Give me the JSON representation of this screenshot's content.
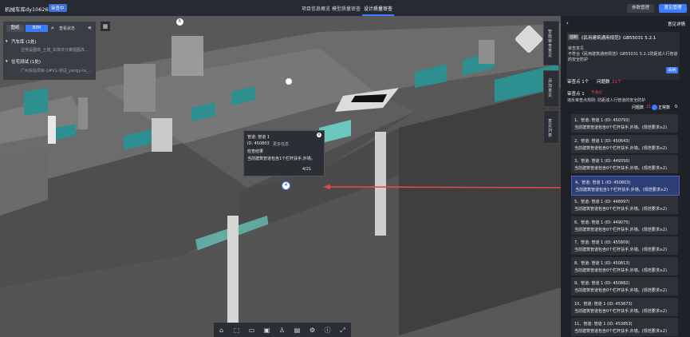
{
  "header": {
    "project": "机械车库dy10626-建筑",
    "badge": "审查中",
    "tabs": [
      "项目信息概览",
      "模型质量审查",
      "设计质量审查"
    ],
    "active_tab": "设计质量审查",
    "btn_params": "参数管理",
    "btn_manage": "意见管理"
  },
  "left_panel": {
    "seg_drawing": "图纸",
    "seg_bim": "BIM",
    "status_label": "查看状态",
    "groups": [
      {
        "label": "汽车库 (1处)",
        "sub": "住宅设图库_土建_车库日分离视图改..."
      },
      {
        "label": "住宅测试 (1处)",
        "sub": "广州东站项目-1#V1-测试_yangy-ta_..."
      }
    ]
  },
  "popup": {
    "line1": "管道: 管道 1",
    "line2": "ID: 450803",
    "more": "更多信息",
    "line3": "检查结果",
    "line4": "当前建筑管道包含1个栏杆扶手,外墙。",
    "pager": "4/21"
  },
  "right_panel": {
    "title": "意见详情",
    "tag": "强制",
    "clause": "《民用建筑通用规范》GB55031 5.2.1",
    "review_label": "审查意见",
    "review_text": "不符合《民用建筑通用规范》GB55031 5.2.1防距成人行管道的安全防护",
    "adopt_btn": "采纳",
    "stats_label": "审查点 1个",
    "issues_label": "问题数",
    "issues_count": "21个",
    "point_label": "审查点 1",
    "point_tag": "不通过",
    "point_desc": "违反审查点规则: 防距成人行管道的安全防护",
    "filter_issue": "问题数",
    "filter_count": "21",
    "filter_correct": "正常数",
    "filter_correct_count": "0",
    "items": [
      {
        "title": "1、管道: 管道 1 (ID: 450793)",
        "desc": "当前建筑管道包含0个栏杆扶手,外墙。(规范要求≥2)",
        "selected": false
      },
      {
        "title": "2、管道: 管道 1 (ID: 450643)",
        "desc": "当前建筑管道包含0个栏杆扶手,外墙。(规范要求≥2)",
        "selected": false
      },
      {
        "title": "3、管道: 管道 1 (ID: 449350)",
        "desc": "当前建筑管道包含0个栏杆扶手,外墙。(规范要求≥2)",
        "selected": false
      },
      {
        "title": "4、管道: 管道 1 (ID: 450803)",
        "desc": "当前建筑管道包含1个栏杆扶手,外墙。(规范要求≥2)",
        "selected": true
      },
      {
        "title": "5、管道: 管道 1 (ID: 448997)",
        "desc": "当前建筑管道包含0个栏杆扶手,外墙。(规范要求≥2)",
        "selected": false
      },
      {
        "title": "6、管道: 管道 1 (ID: 449075)",
        "desc": "当前建筑管道包含0个栏杆扶手,外墙。(规范要求≥2)",
        "selected": false
      },
      {
        "title": "7、管道: 管道 1 (ID: 455809)",
        "desc": "当前建筑管道包含0个栏杆扶手,外墙。(规范要求≥2)",
        "selected": false
      },
      {
        "title": "8、管道: 管道 1 (ID: 450813)",
        "desc": "当前建筑管道包含0个栏杆扶手,外墙。(规范要求≥2)",
        "selected": false
      },
      {
        "title": "9、管道: 管道 1 (ID: 450882)",
        "desc": "当前建筑管道包含0个栏杆扶手,外墙。(规范要求≥2)",
        "selected": false
      },
      {
        "title": "10、管道: 管道 1 (ID: 453673)",
        "desc": "当前建筑管道包含0个栏杆扶手,外墙。(规范要求≥2)",
        "selected": false
      },
      {
        "title": "11、管道: 管道 1 (ID: 453853)",
        "desc": "当前建筑管道包含0个栏杆扶手,外墙。(规范要求≥2)",
        "selected": false
      }
    ]
  },
  "side_tabs": [
    "智能审查意见",
    "添加意见",
    "意见列表"
  ],
  "markers": [
    "4",
    "6"
  ],
  "colors": {
    "accent": "#3a7bff",
    "danger": "#e24b4b",
    "teal": "#2a8c8c"
  }
}
